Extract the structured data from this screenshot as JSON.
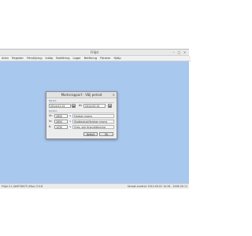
{
  "app": {
    "title": "Fröjd",
    "window_buttons": [
      "–",
      "□",
      "×"
    ]
  },
  "menubar": {
    "items": [
      "Arkiv",
      "Register",
      "Försäljning",
      "Inköp",
      "Bokföring",
      "Lager",
      "Betfimng",
      "Fönster",
      "Hjälp"
    ]
  },
  "statusbar": {
    "left": "Fröjd 2.1.0b9TS6075 (Mac) 3.0.8",
    "right": "Senast använd: 2010-09-02 10:26 - 2006-09-11"
  },
  "dialog": {
    "title": "Momsrapport - Välj period",
    "close": "×",
    "period_label": "Period",
    "from_date": "2014-01-01",
    "to_label": "till",
    "to_date": "2014-03-31",
    "calendar_glyph": "▦",
    "accounts_label": "Konton",
    "rows": [
      {
        "prefix": "Ut:",
        "value": "2650",
        "description": "Fordran moms"
      },
      {
        "prefix": "In:",
        "value": "2650",
        "description": "Skatteskuld/fordran moms"
      },
      {
        "prefix": "K:",
        "value": "1030",
        "description": "Öres- och Kronutjämning"
      }
    ],
    "pick_glyph": "↘",
    "buttons": {
      "cancel": "Avbryt",
      "ok": "Ok"
    }
  }
}
